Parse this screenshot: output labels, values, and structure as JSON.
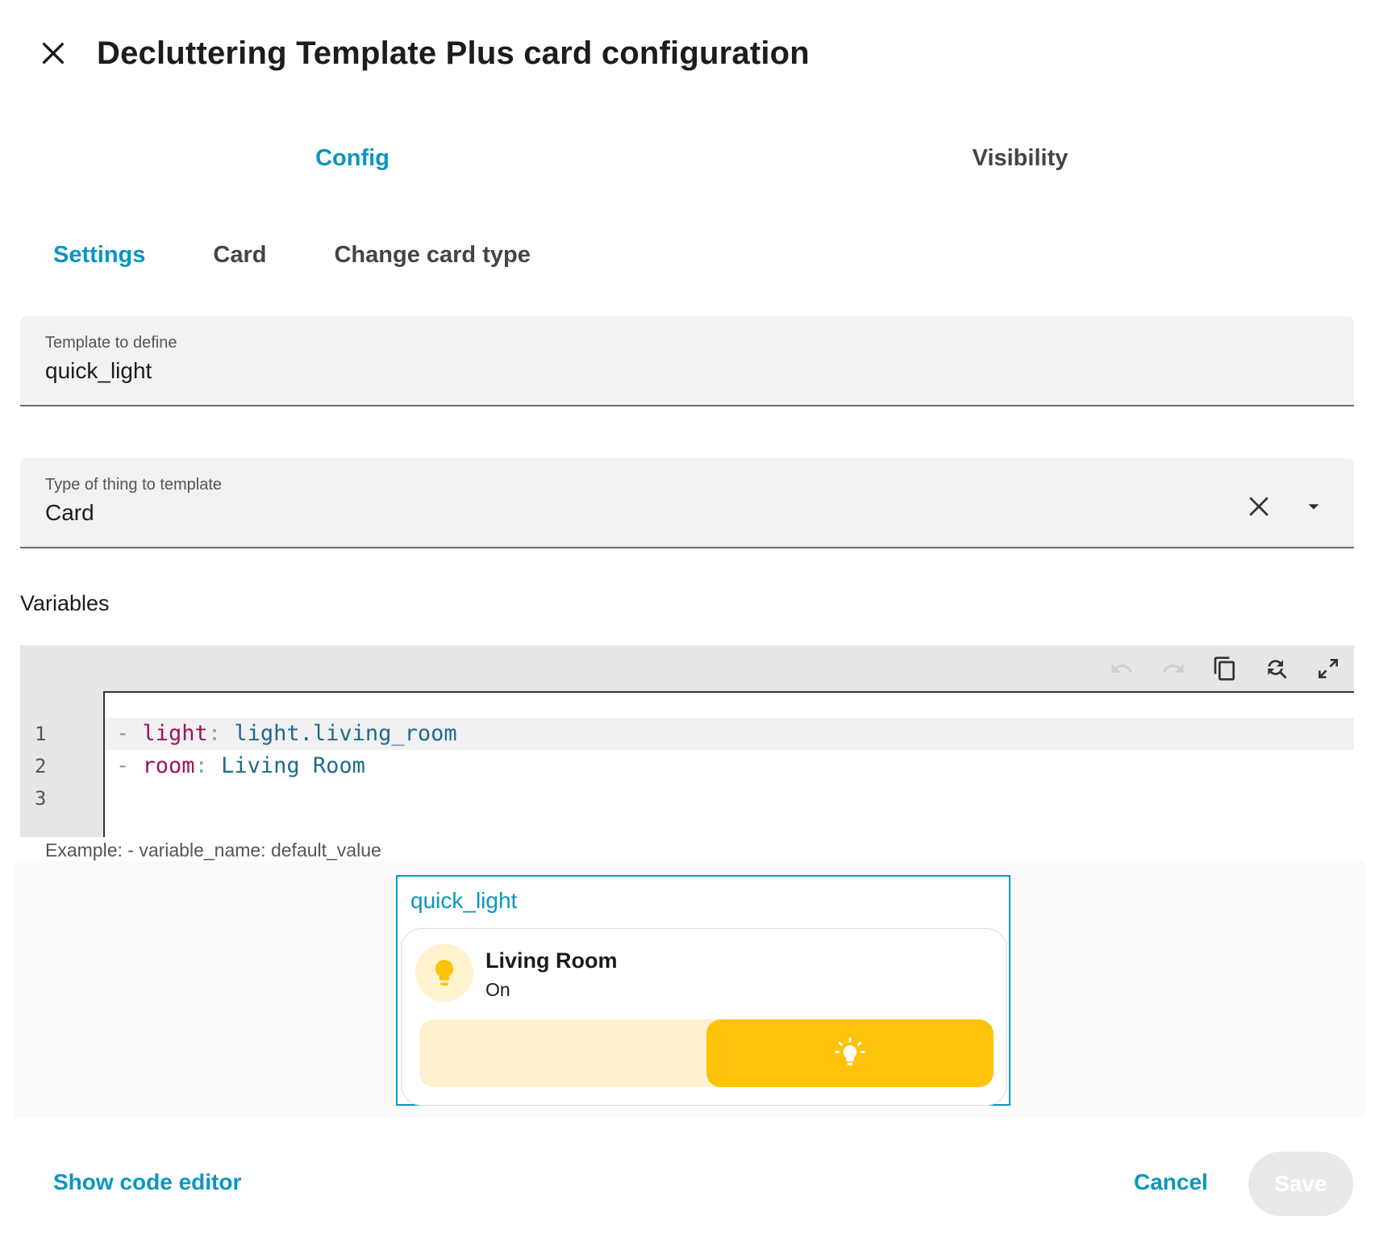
{
  "dialog": {
    "title": "Decluttering Template Plus card configuration",
    "close_icon": "close-icon"
  },
  "tabs_main": [
    {
      "label": "Config",
      "active": true
    },
    {
      "label": "Visibility",
      "active": false
    }
  ],
  "tabs_sub": [
    {
      "label": "Settings",
      "active": true
    },
    {
      "label": "Card",
      "active": false
    },
    {
      "label": "Change card type",
      "active": false
    }
  ],
  "template_field": {
    "label": "Template to define",
    "value": "quick_light"
  },
  "type_field": {
    "label": "Type of thing to template",
    "value": "Card",
    "clear_icon": "close-icon",
    "dropdown_icon": "menu-down-icon"
  },
  "variables": {
    "title": "Variables",
    "toolbar_icons": [
      "undo-icon",
      "redo-icon",
      "copy-icon",
      "search-replace-icon",
      "fullscreen-icon"
    ],
    "line_numbers": [
      "1",
      "2",
      "3"
    ],
    "lines": [
      {
        "dash": "-",
        "key": "light",
        "colon": ":",
        "value": "light.living_room"
      },
      {
        "dash": "-",
        "key": "room",
        "colon": ":",
        "value": "Living Room"
      }
    ],
    "helper": "Example: - variable_name: default_value"
  },
  "preview": {
    "template_name": "quick_light",
    "tile": {
      "name": "Living Room",
      "state": "On",
      "icon": "lightbulb-icon",
      "slider_icon": "lightbulb-on-icon",
      "brightness_fraction": 0.5
    }
  },
  "footer": {
    "show_code": "Show code editor",
    "cancel": "Cancel",
    "save": "Save"
  },
  "colors": {
    "accent": "#0a95c4",
    "light_on": "#fdc20a"
  }
}
